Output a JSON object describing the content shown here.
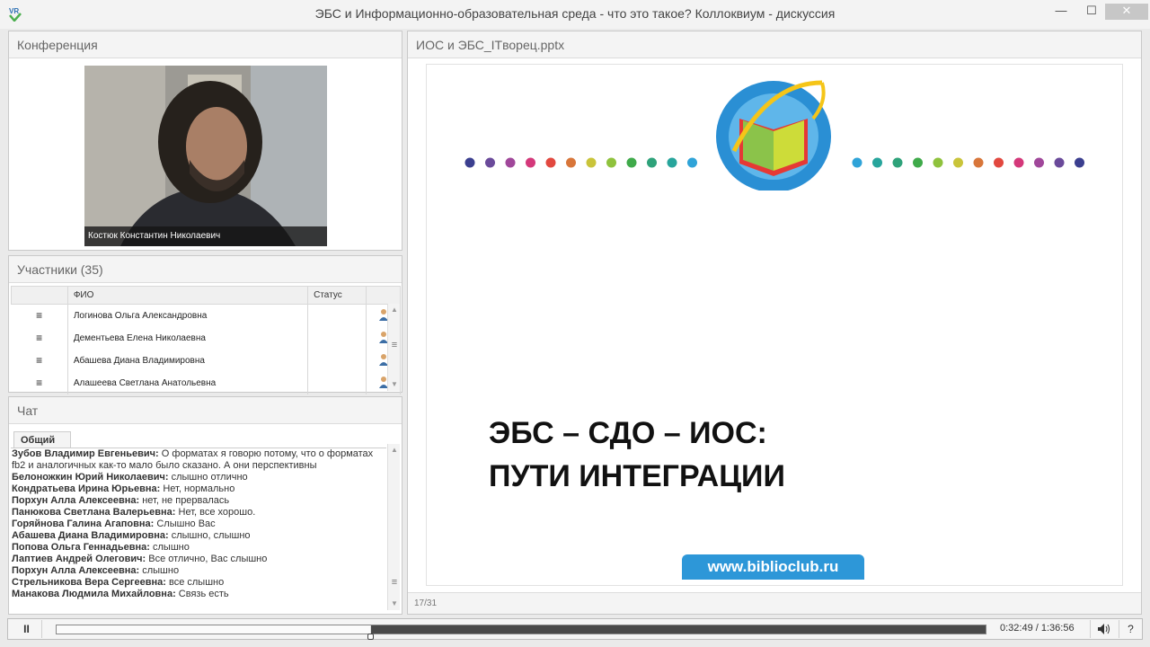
{
  "window": {
    "title": "ЭБС и Информационно-образовательная среда - что это такое? Коллоквиум - дискуссия",
    "minimize": "—",
    "maximize": "☐",
    "close": "✕"
  },
  "conference": {
    "title": "Конференция",
    "speaker_name": "Костюк Константин Николаевич"
  },
  "participants": {
    "title": "Участники (35)",
    "col_name": "ФИО",
    "col_status": "Статус",
    "rows": [
      {
        "name": "Логинова Ольга Александровна",
        "status": ""
      },
      {
        "name": "Дементьева Елена Николаевна",
        "status": ""
      },
      {
        "name": "Абашева  Диана Владимировна",
        "status": ""
      },
      {
        "name": "Алашеева Светлана Анатольевна",
        "status": ""
      }
    ]
  },
  "chat": {
    "title": "Чат",
    "tab": "Общий",
    "messages": [
      {
        "author": "Зубов Владимир Евгеньевич:",
        "text": " О форматах я говорю потому, что  о форматах fb2  и аналогичных как-то мало было сказано. А они перспективны"
      },
      {
        "author": "Белоножкин Юрий Николаевич:",
        "text": " слышно отлично"
      },
      {
        "author": "Кондратьева Ирина  Юрьевна:",
        "text": " Нет, нормально"
      },
      {
        "author": "Порхун Алла Алексеевна:",
        "text": " нет, не прервалась"
      },
      {
        "author": "Панюкова Светлана Валерьевна:",
        "text": " Нет, все хорошо."
      },
      {
        "author": "Горяйнова Галина  Агаповна:",
        "text": " Слышно Вас"
      },
      {
        "author": "Абашева  Диана Владимировна:",
        "text": " слышно, слышно"
      },
      {
        "author": "Попова  Ольга Геннадьевна:",
        "text": " слышно"
      },
      {
        "author": "Лаптиев Андрей  Олегович:",
        "text": " Все отлично, Вас слышно"
      },
      {
        "author": "Порхун Алла Алексеевна:",
        "text": " слышно"
      },
      {
        "author": "Стрельникова Вера  Сергеевна:",
        "text": " все слышно"
      },
      {
        "author": "Манакова Людмила Михайловна:",
        "text": " Связь есть"
      }
    ]
  },
  "presentation": {
    "file_name": "ИОС и ЭБС_ITворец.pptx",
    "slide_line1": "ЭБС – СДО – ИОС:",
    "slide_line2": "ПУТИ ИНТЕГРАЦИИ",
    "site": "www.biblioclub.ru",
    "page": "17/31",
    "dot_colors": [
      "#3b3f8f",
      "#6a4a9a",
      "#a0479a",
      "#d4387a",
      "#e2483f",
      "#d8763a",
      "#c9c43a",
      "#8fc23d",
      "#3faa4a",
      "#2ea27a",
      "#27a59c",
      "#2fa3d8"
    ]
  },
  "player": {
    "pause": "II",
    "time": "0:32:49 / 1:36:56",
    "progress": 0.338,
    "volume_icon": "speaker-icon",
    "help": "?"
  }
}
